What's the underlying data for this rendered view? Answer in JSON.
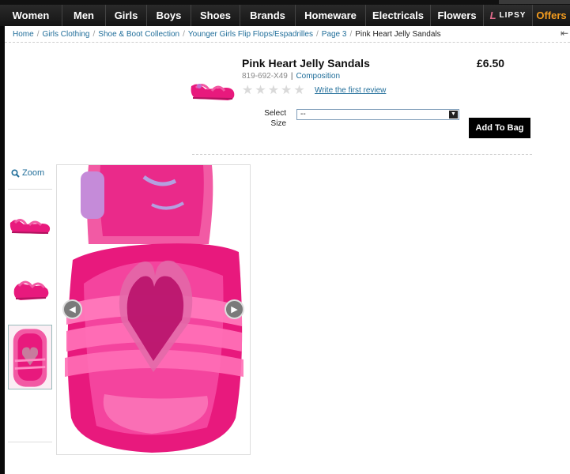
{
  "nav": {
    "items": [
      "Women",
      "Men",
      "Girls",
      "Boys",
      "Shoes",
      "Brands",
      "Homeware",
      "Electricals",
      "Flowers"
    ],
    "lipsy_label": "LIPSY",
    "offers_label": "Offers"
  },
  "breadcrumb": {
    "items": [
      "Home",
      "Girls Clothing",
      "Shoe & Boot Collection",
      "Younger Girls Flip Flops/Espadrilles",
      "Page 3"
    ],
    "current": "Pink Heart Jelly Sandals"
  },
  "product": {
    "title": "Pink Heart Jelly Sandals",
    "price": "£6.50",
    "code": "819-692-X49",
    "composition_link": "Composition",
    "review_link": "Write the first review",
    "rating": 0,
    "size_label_line1": "Select",
    "size_label_line2": "Size",
    "size_value": "--",
    "add_to_bag": "Add To Bag"
  },
  "gallery": {
    "zoom_label": "Zoom"
  },
  "colors": {
    "accent_link": "#1f6d99",
    "offers": "#f39c1f",
    "product_pink": "#e8197d"
  }
}
